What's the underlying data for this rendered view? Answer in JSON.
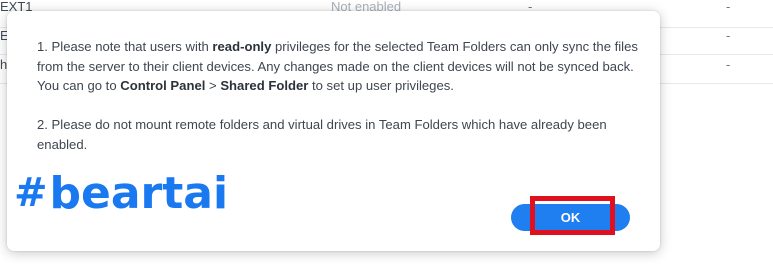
{
  "background_table": {
    "rows": [
      {
        "name": "EXT1",
        "status": "Not enabled",
        "col3": "-",
        "col4": "-"
      },
      {
        "name": "E",
        "status": "",
        "col3": "",
        "col4": "-"
      },
      {
        "name": "h",
        "status": "",
        "col3": "",
        "col4": "-"
      }
    ]
  },
  "dialog": {
    "note1": {
      "prefix": "1. Please note that users with ",
      "bold1": "read-only",
      "suffix": " privileges for the selected Team Folders can only sync the files from the server to their client devices. Any changes made on the client devices will not be synced back.",
      "line2_prefix": "You can go to ",
      "bold2": "Control Panel",
      "sep": " > ",
      "bold3": "Shared Folder",
      "line2_suffix": " to set up user privileges."
    },
    "note2": "2. Please do not mount remote folders and virtual drives in Team Folders which have already been enabled.",
    "ok_label": "OK"
  },
  "watermark": {
    "hash": "#",
    "text": "beartai",
    "color": "#1a78f0"
  },
  "colors": {
    "button": "#1f7ef0",
    "highlight": "#e0101f"
  }
}
